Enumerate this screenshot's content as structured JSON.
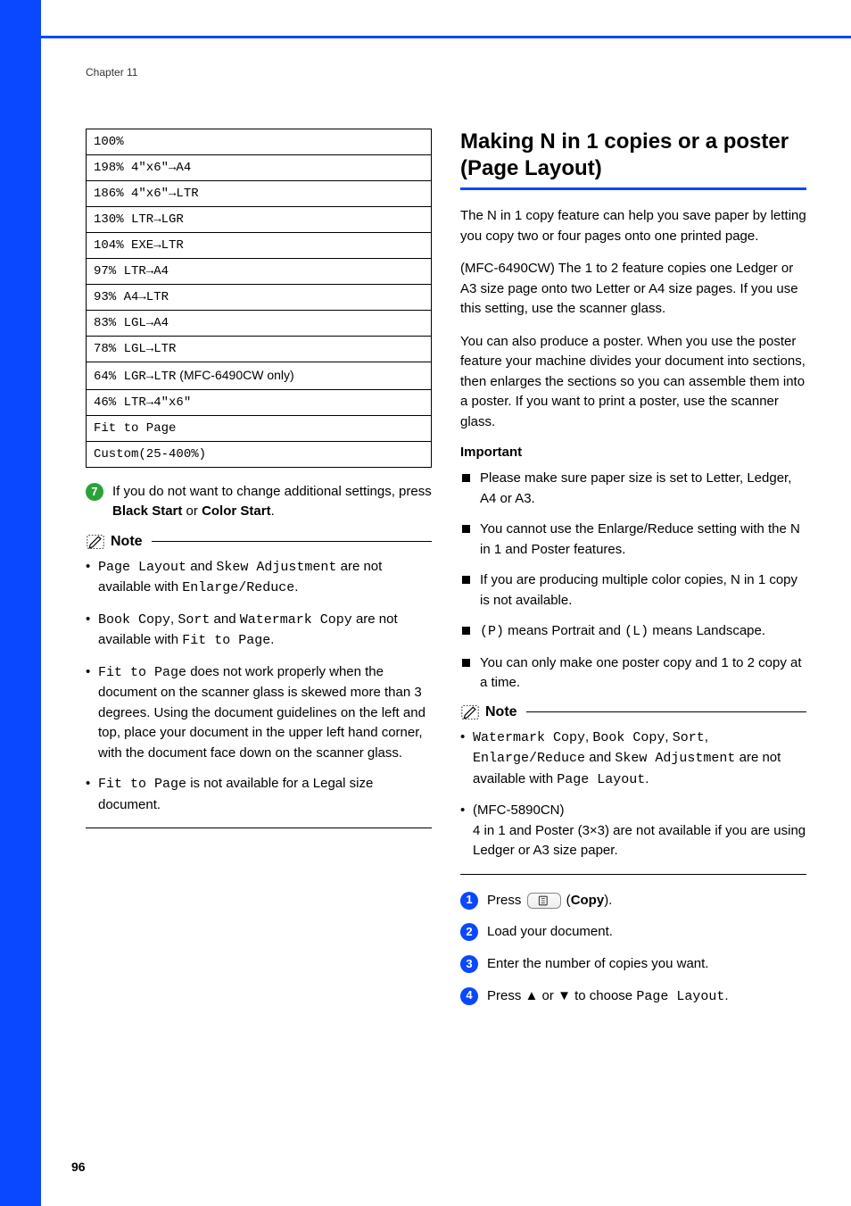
{
  "meta": {
    "chapter": "Chapter 11",
    "page_number": "96"
  },
  "left": {
    "table_rows": [
      {
        "text": "100%"
      },
      {
        "text": "198% 4\"x6\"→A4"
      },
      {
        "text": "186% 4\"x6\"→LTR"
      },
      {
        "text": "130% LTR→LGR"
      },
      {
        "text": "104% EXE→LTR"
      },
      {
        "text": "97% LTR→A4"
      },
      {
        "text": "93% A4→LTR"
      },
      {
        "text": "83% LGL→A4"
      },
      {
        "text": "78% LGL→LTR"
      },
      {
        "text": "64% LGR→LTR",
        "suffix": " (MFC-6490CW only)"
      },
      {
        "text": "46% LTR→4\"x6\""
      },
      {
        "text": "Fit to Page"
      },
      {
        "text": "Custom(25-400%)"
      }
    ],
    "step7": {
      "pre": "If you do not want to change additional settings, press ",
      "b1": "Black Start",
      "mid": " or ",
      "b2": "Color Start",
      "post": "."
    },
    "note_label": "Note",
    "notes": [
      {
        "parts": [
          {
            "t": "Page Layout",
            "mono": true
          },
          {
            "t": " and "
          },
          {
            "t": "Skew Adjustment",
            "mono": true
          },
          {
            "t": " are not available with "
          },
          {
            "t": "Enlarge/Reduce",
            "mono": true
          },
          {
            "t": "."
          }
        ]
      },
      {
        "parts": [
          {
            "t": "Book Copy",
            "mono": true
          },
          {
            "t": ", "
          },
          {
            "t": "Sort",
            "mono": true
          },
          {
            "t": " and "
          },
          {
            "t": "Watermark Copy",
            "mono": true
          },
          {
            "t": " are not available with "
          },
          {
            "t": "Fit to Page",
            "mono": true
          },
          {
            "t": "."
          }
        ]
      },
      {
        "parts": [
          {
            "t": "Fit to Page",
            "mono": true
          },
          {
            "t": " does not work properly when the document on the scanner glass is skewed more than 3 degrees. Using the document guidelines on the left and top, place your document in the upper left hand corner, with the document face down on the scanner glass."
          }
        ]
      },
      {
        "parts": [
          {
            "t": "Fit to Page",
            "mono": true
          },
          {
            "t": " is not available for a Legal size document."
          }
        ]
      }
    ]
  },
  "right": {
    "heading": "Making N in 1 copies or a poster (Page Layout)",
    "paras": [
      "The N in 1 copy feature can help you save paper by letting you copy two or four pages onto one printed page.",
      "(MFC-6490CW) The 1 to 2 feature copies one Ledger or A3 size page onto two Letter or A4 size pages. If you use this setting, use the scanner glass.",
      "You can also produce a poster. When you use the poster feature your machine divides your document into sections, then enlarges the sections so you can assemble them into a poster. If you want to print a poster, use the scanner glass."
    ],
    "important_label": "Important",
    "important": [
      "Please make sure paper size is set to Letter, Ledger, A4 or A3.",
      "You cannot use the Enlarge/Reduce setting with the N in 1 and Poster features.",
      "If you are producing multiple color copies, N in 1 copy is not available.",
      null,
      "You can only make one poster copy and 1 to 2 copy at a time."
    ],
    "important_pl": {
      "p1": "(P)",
      "mid1": " means Portrait and ",
      "p2": "(L)",
      "mid2": " means Landscape."
    },
    "note_label": "Note",
    "notes2": [
      {
        "parts": [
          {
            "t": "Watermark Copy",
            "mono": true
          },
          {
            "t": ", "
          },
          {
            "t": "Book Copy",
            "mono": true
          },
          {
            "t": ", "
          },
          {
            "t": "Sort",
            "mono": true
          },
          {
            "t": ", "
          },
          {
            "t": "Enlarge/Reduce",
            "mono": true
          },
          {
            "t": " and "
          },
          {
            "t": "Skew Adjustment",
            "mono": true
          },
          {
            "t": " are not available with "
          },
          {
            "t": "Page Layout",
            "mono": true
          },
          {
            "t": "."
          }
        ]
      },
      {
        "parts": [
          {
            "t": "(MFC-5890CN)\n4 in 1 and Poster (3×3) are not available if you are using Ledger or A3 size paper."
          }
        ]
      }
    ],
    "steps": {
      "s1": {
        "pre": "Press ",
        "btn": "copy",
        "post_open": " (",
        "bold": "Copy",
        "post_close": ")."
      },
      "s2": "Load your document.",
      "s3": "Enter the number of copies you want.",
      "s4": {
        "pre": "Press ",
        "up": "▲",
        "mid": " or ",
        "down": "▼",
        "mid2": " to choose ",
        "mono": "Page Layout",
        "post": "."
      }
    }
  }
}
